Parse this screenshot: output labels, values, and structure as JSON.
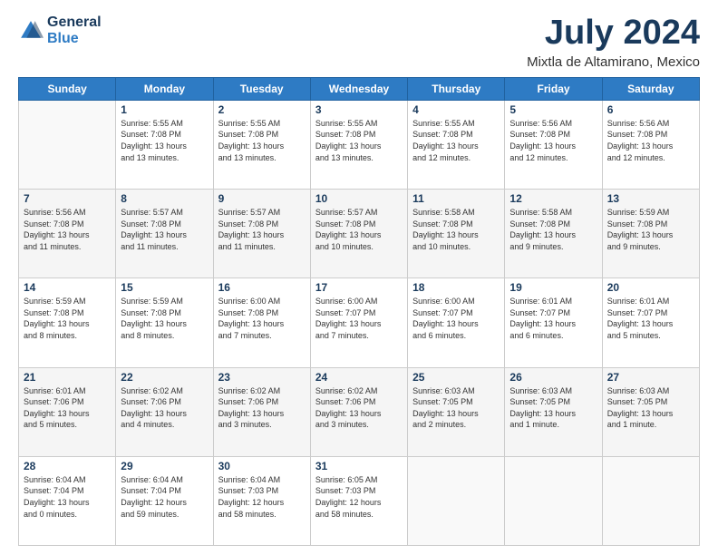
{
  "header": {
    "logo_line1": "General",
    "logo_line2": "Blue",
    "month": "July 2024",
    "location": "Mixtla de Altamirano, Mexico"
  },
  "weekdays": [
    "Sunday",
    "Monday",
    "Tuesday",
    "Wednesday",
    "Thursday",
    "Friday",
    "Saturday"
  ],
  "weeks": [
    [
      {
        "day": "",
        "info": ""
      },
      {
        "day": "1",
        "info": "Sunrise: 5:55 AM\nSunset: 7:08 PM\nDaylight: 13 hours\nand 13 minutes."
      },
      {
        "day": "2",
        "info": "Sunrise: 5:55 AM\nSunset: 7:08 PM\nDaylight: 13 hours\nand 13 minutes."
      },
      {
        "day": "3",
        "info": "Sunrise: 5:55 AM\nSunset: 7:08 PM\nDaylight: 13 hours\nand 13 minutes."
      },
      {
        "day": "4",
        "info": "Sunrise: 5:55 AM\nSunset: 7:08 PM\nDaylight: 13 hours\nand 12 minutes."
      },
      {
        "day": "5",
        "info": "Sunrise: 5:56 AM\nSunset: 7:08 PM\nDaylight: 13 hours\nand 12 minutes."
      },
      {
        "day": "6",
        "info": "Sunrise: 5:56 AM\nSunset: 7:08 PM\nDaylight: 13 hours\nand 12 minutes."
      }
    ],
    [
      {
        "day": "7",
        "info": "Sunrise: 5:56 AM\nSunset: 7:08 PM\nDaylight: 13 hours\nand 11 minutes."
      },
      {
        "day": "8",
        "info": "Sunrise: 5:57 AM\nSunset: 7:08 PM\nDaylight: 13 hours\nand 11 minutes."
      },
      {
        "day": "9",
        "info": "Sunrise: 5:57 AM\nSunset: 7:08 PM\nDaylight: 13 hours\nand 11 minutes."
      },
      {
        "day": "10",
        "info": "Sunrise: 5:57 AM\nSunset: 7:08 PM\nDaylight: 13 hours\nand 10 minutes."
      },
      {
        "day": "11",
        "info": "Sunrise: 5:58 AM\nSunset: 7:08 PM\nDaylight: 13 hours\nand 10 minutes."
      },
      {
        "day": "12",
        "info": "Sunrise: 5:58 AM\nSunset: 7:08 PM\nDaylight: 13 hours\nand 9 minutes."
      },
      {
        "day": "13",
        "info": "Sunrise: 5:59 AM\nSunset: 7:08 PM\nDaylight: 13 hours\nand 9 minutes."
      }
    ],
    [
      {
        "day": "14",
        "info": "Sunrise: 5:59 AM\nSunset: 7:08 PM\nDaylight: 13 hours\nand 8 minutes."
      },
      {
        "day": "15",
        "info": "Sunrise: 5:59 AM\nSunset: 7:08 PM\nDaylight: 13 hours\nand 8 minutes."
      },
      {
        "day": "16",
        "info": "Sunrise: 6:00 AM\nSunset: 7:08 PM\nDaylight: 13 hours\nand 7 minutes."
      },
      {
        "day": "17",
        "info": "Sunrise: 6:00 AM\nSunset: 7:07 PM\nDaylight: 13 hours\nand 7 minutes."
      },
      {
        "day": "18",
        "info": "Sunrise: 6:00 AM\nSunset: 7:07 PM\nDaylight: 13 hours\nand 6 minutes."
      },
      {
        "day": "19",
        "info": "Sunrise: 6:01 AM\nSunset: 7:07 PM\nDaylight: 13 hours\nand 6 minutes."
      },
      {
        "day": "20",
        "info": "Sunrise: 6:01 AM\nSunset: 7:07 PM\nDaylight: 13 hours\nand 5 minutes."
      }
    ],
    [
      {
        "day": "21",
        "info": "Sunrise: 6:01 AM\nSunset: 7:06 PM\nDaylight: 13 hours\nand 5 minutes."
      },
      {
        "day": "22",
        "info": "Sunrise: 6:02 AM\nSunset: 7:06 PM\nDaylight: 13 hours\nand 4 minutes."
      },
      {
        "day": "23",
        "info": "Sunrise: 6:02 AM\nSunset: 7:06 PM\nDaylight: 13 hours\nand 3 minutes."
      },
      {
        "day": "24",
        "info": "Sunrise: 6:02 AM\nSunset: 7:06 PM\nDaylight: 13 hours\nand 3 minutes."
      },
      {
        "day": "25",
        "info": "Sunrise: 6:03 AM\nSunset: 7:05 PM\nDaylight: 13 hours\nand 2 minutes."
      },
      {
        "day": "26",
        "info": "Sunrise: 6:03 AM\nSunset: 7:05 PM\nDaylight: 13 hours\nand 1 minute."
      },
      {
        "day": "27",
        "info": "Sunrise: 6:03 AM\nSunset: 7:05 PM\nDaylight: 13 hours\nand 1 minute."
      }
    ],
    [
      {
        "day": "28",
        "info": "Sunrise: 6:04 AM\nSunset: 7:04 PM\nDaylight: 13 hours\nand 0 minutes."
      },
      {
        "day": "29",
        "info": "Sunrise: 6:04 AM\nSunset: 7:04 PM\nDaylight: 12 hours\nand 59 minutes."
      },
      {
        "day": "30",
        "info": "Sunrise: 6:04 AM\nSunset: 7:03 PM\nDaylight: 12 hours\nand 58 minutes."
      },
      {
        "day": "31",
        "info": "Sunrise: 6:05 AM\nSunset: 7:03 PM\nDaylight: 12 hours\nand 58 minutes."
      },
      {
        "day": "",
        "info": ""
      },
      {
        "day": "",
        "info": ""
      },
      {
        "day": "",
        "info": ""
      }
    ]
  ]
}
